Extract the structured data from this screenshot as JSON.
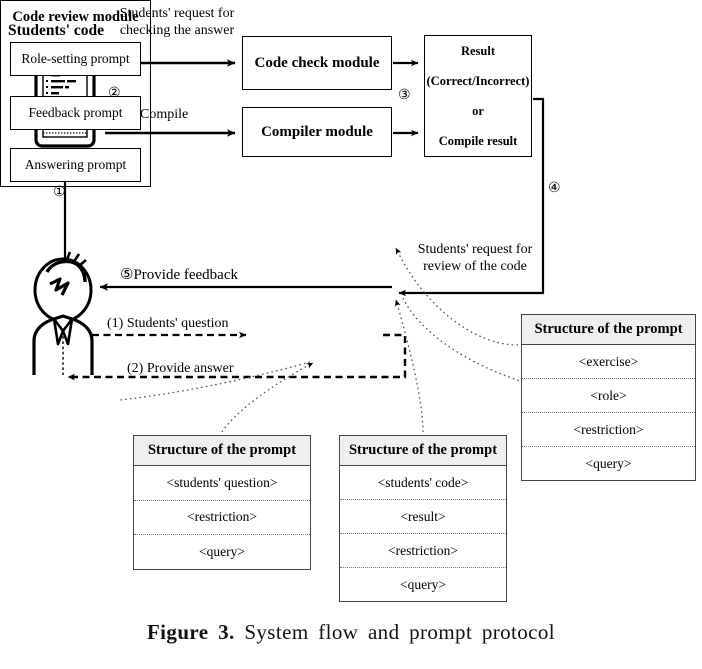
{
  "figure": {
    "number": "Figure 3.",
    "caption": "System flow and prompt protocol"
  },
  "actors": {
    "students_code_title": "Students' code",
    "device_icon": "tablet-code-icon",
    "student_icon": "student-person-icon"
  },
  "modules": {
    "code_check": "Code check module",
    "compiler": "Compiler module",
    "result_line1": "Result",
    "result_line2": "(Correct/Incorrect)",
    "result_line3": "or",
    "result_line4": "Compile result",
    "code_review_title": "Code review module",
    "role_setting_prompt": "Role-setting prompt",
    "feedback_prompt": "Feedback prompt",
    "answering_prompt": "Answering prompt"
  },
  "edges": {
    "request_check_l1": "Students' request for",
    "request_check_l2": "checking the answer",
    "compile": "Compile",
    "step1": "①",
    "step2": "②",
    "step3": "③",
    "step4": "④",
    "step5_feedback": "⑤Provide feedback",
    "students_question": "(1) Students' question",
    "provide_answer": "(2) Provide answer",
    "request_review_l1": "Students' request for",
    "request_review_l2": "review of the code"
  },
  "structure_right": {
    "header": "Structure of the prompt",
    "rows": [
      "<exercise>",
      "<role>",
      "<restriction>",
      "<query>"
    ]
  },
  "structure_question": {
    "header": "Structure of the prompt",
    "rows": [
      "<students' question>",
      "<restriction>",
      "<query>"
    ]
  },
  "structure_code": {
    "header": "Structure of the prompt",
    "rows": [
      "<students' code>",
      "<result>",
      "<restriction>",
      "<query>"
    ]
  },
  "colors": {
    "line": "#000000",
    "header_fill": "#efefef",
    "border": "#444444",
    "dotted": "#777777"
  }
}
